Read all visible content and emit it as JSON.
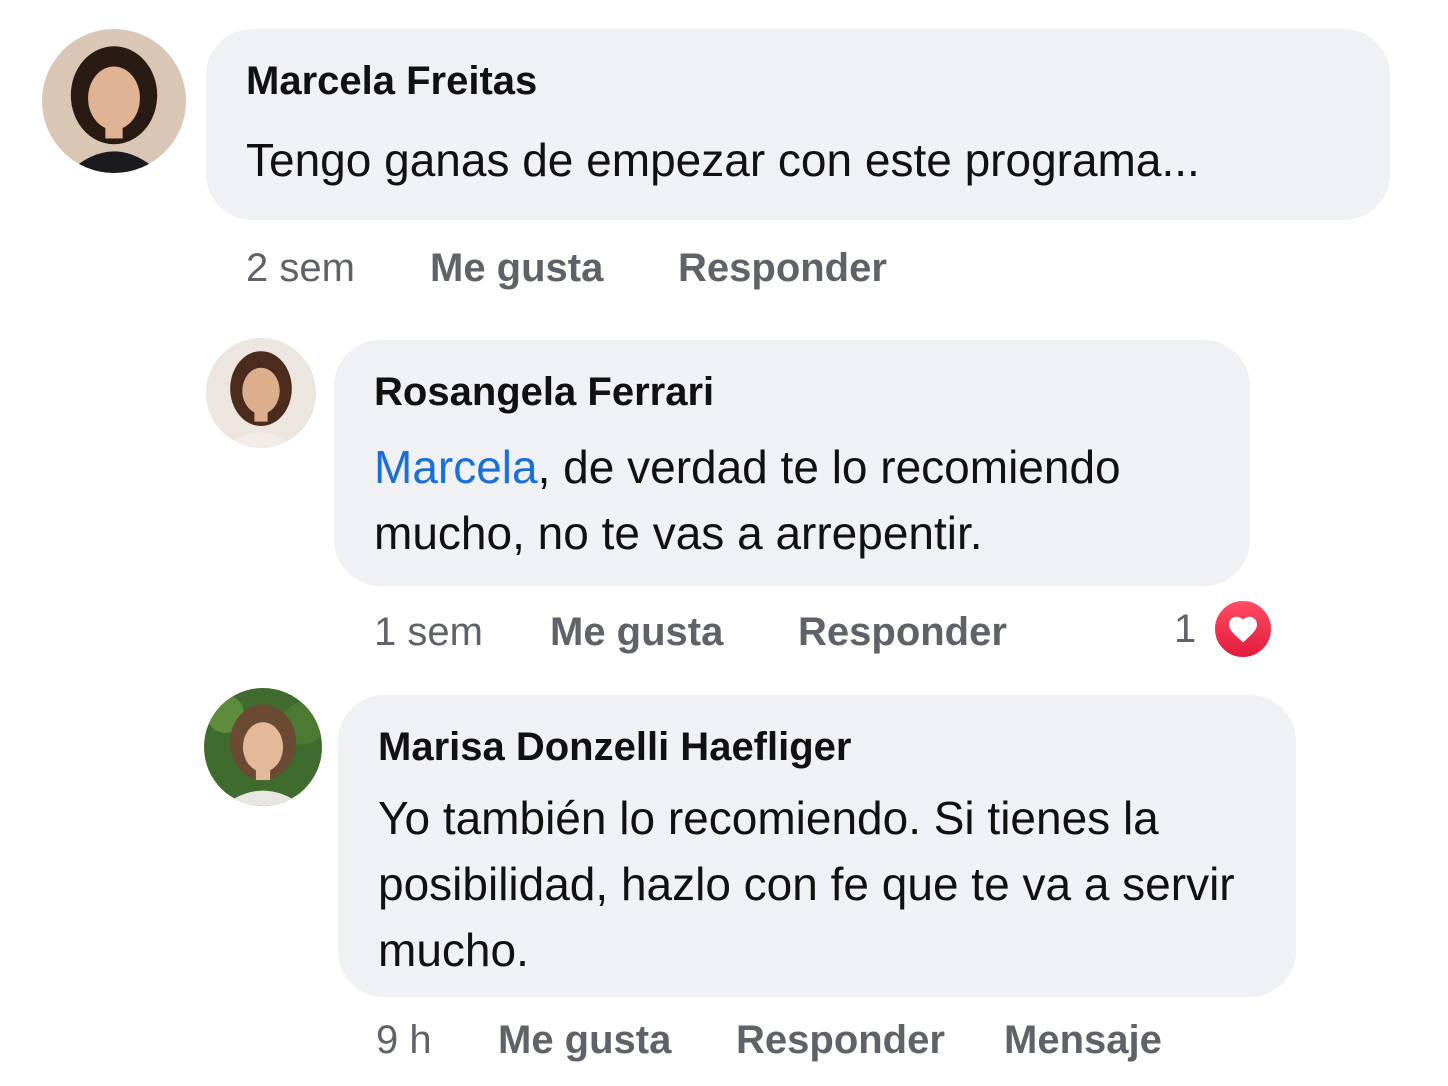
{
  "comments": [
    {
      "author": "Marcela Freitas",
      "text": "Tengo ganas de empezar con este programa...",
      "time": "2 sem",
      "like_label": "Me gusta",
      "reply_label": "Responder"
    },
    {
      "author": "Rosangela Ferrari",
      "mention": "Marcela",
      "text_after_mention": ", de verdad te lo recomiendo",
      "text_line2": "mucho, no te vas a arrepentir.",
      "time": "1 sem",
      "like_label": "Me gusta",
      "reply_label": "Responder",
      "reaction_count": "1",
      "reaction_icon": "heart-icon"
    },
    {
      "author": "Marisa Donzelli Haefliger",
      "text_line1": "Yo también lo recomiendo. Si tienes la",
      "text_line2": "posibilidad, hazlo con fe que te va a servir",
      "text_line3": "mucho.",
      "time": "9 h",
      "like_label": "Me gusta",
      "reply_label": "Responder",
      "message_label": "Mensaje"
    }
  ],
  "colors": {
    "bubble": "#f0f1f4",
    "mention": "#1b6fd8",
    "meta": "#5f6268",
    "heart": "#e8253f"
  }
}
